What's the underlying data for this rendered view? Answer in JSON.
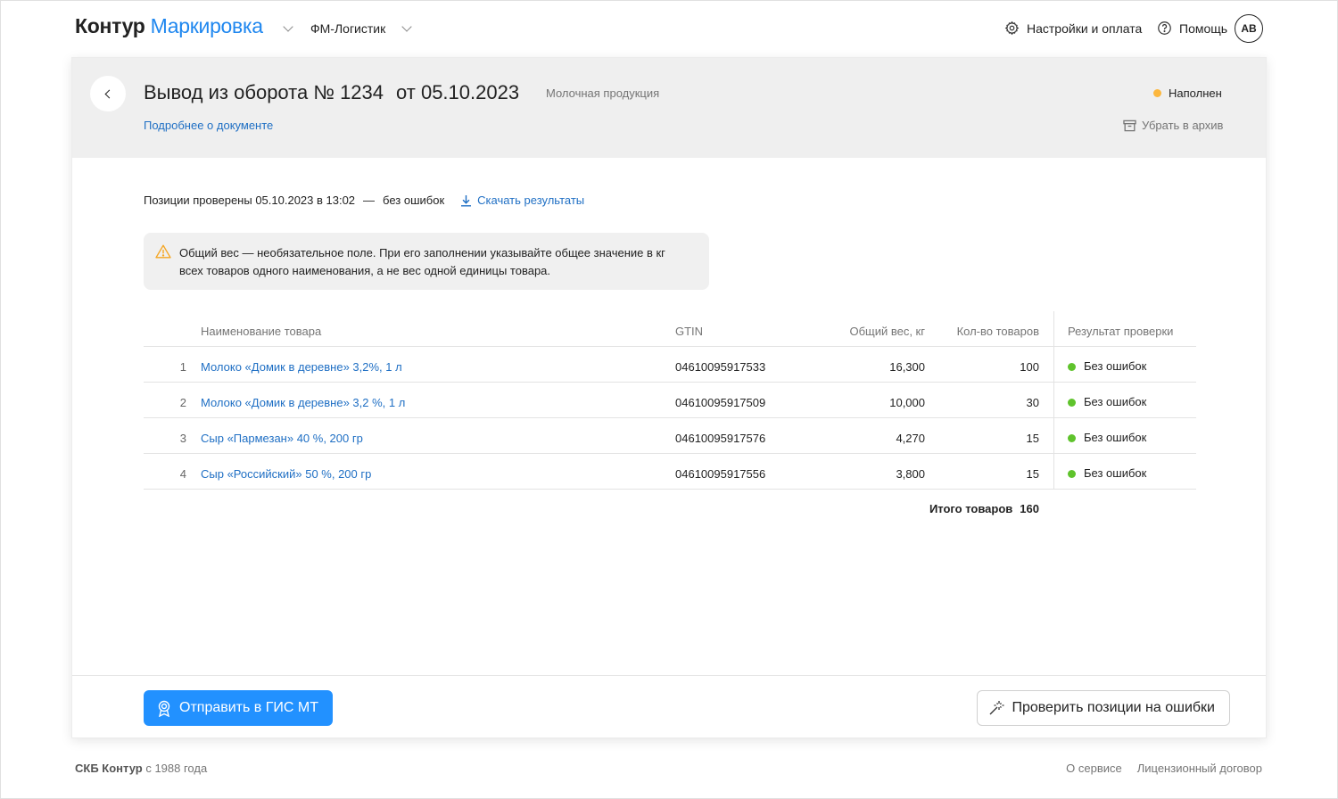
{
  "header": {
    "brand": "Контур",
    "product": "Маркировка",
    "org": "ФМ-Логистик",
    "settings_label": "Настройки и оплата",
    "help_label": "Помощь",
    "avatar_initials": "АВ"
  },
  "document": {
    "title": "Вывод из оборота № 1234",
    "date": "от 05.10.2023",
    "category": "Молочная продукция",
    "more_link": "Подробнее о документе",
    "status": "Наполнен",
    "status_color": "#fcb73e",
    "archive_label": "Убрать в архив"
  },
  "check": {
    "text": "Позиции проверены 05.10.2023 в 13:02",
    "dash": "—",
    "result": "без ошибок",
    "download_label": "Скачать результаты"
  },
  "notice": {
    "line1": "Общий вес — необязательное поле. При его заполнении указывайте общее значение в кг",
    "line2": "всех товаров одного наименования, а не вес одной единицы товара."
  },
  "table": {
    "headers": {
      "name": "Наименование товара",
      "gtin": "GTIN",
      "weight": "Общий вес, кг",
      "qty": "Кол-во товаров",
      "result": "Результат проверки"
    },
    "rows": [
      {
        "num": "1",
        "name": "Молоко «Домик в деревне» 3,2%, 1 л",
        "gtin": "04610095917533",
        "weight": "16,300",
        "qty": "100",
        "result": "Без ошибок"
      },
      {
        "num": "2",
        "name": "Молоко «Домик в деревне» 3,2 %, 1 л",
        "gtin": "04610095917509",
        "weight": "10,000",
        "qty": "30",
        "result": "Без ошибок"
      },
      {
        "num": "3",
        "name": "Сыр «Пармезан» 40 %, 200 гр",
        "gtin": "04610095917576",
        "weight": "4,270",
        "qty": "15",
        "result": "Без ошибок"
      },
      {
        "num": "4",
        "name": "Сыр «Российский» 50 %, 200 гр",
        "gtin": "04610095917556",
        "weight": "3,800",
        "qty": "15",
        "result": "Без ошибок"
      }
    ],
    "ok_color": "#5fc32c",
    "total_label": "Итого товаров",
    "total_value": "160"
  },
  "actions": {
    "send_label": "Отправить в ГИС МТ",
    "check_label": "Проверить позиции на ошибки"
  },
  "footer": {
    "company": "СКБ Контур",
    "since": "с 1988 года",
    "about": "О сервисе",
    "license": "Лицензионный договор"
  }
}
